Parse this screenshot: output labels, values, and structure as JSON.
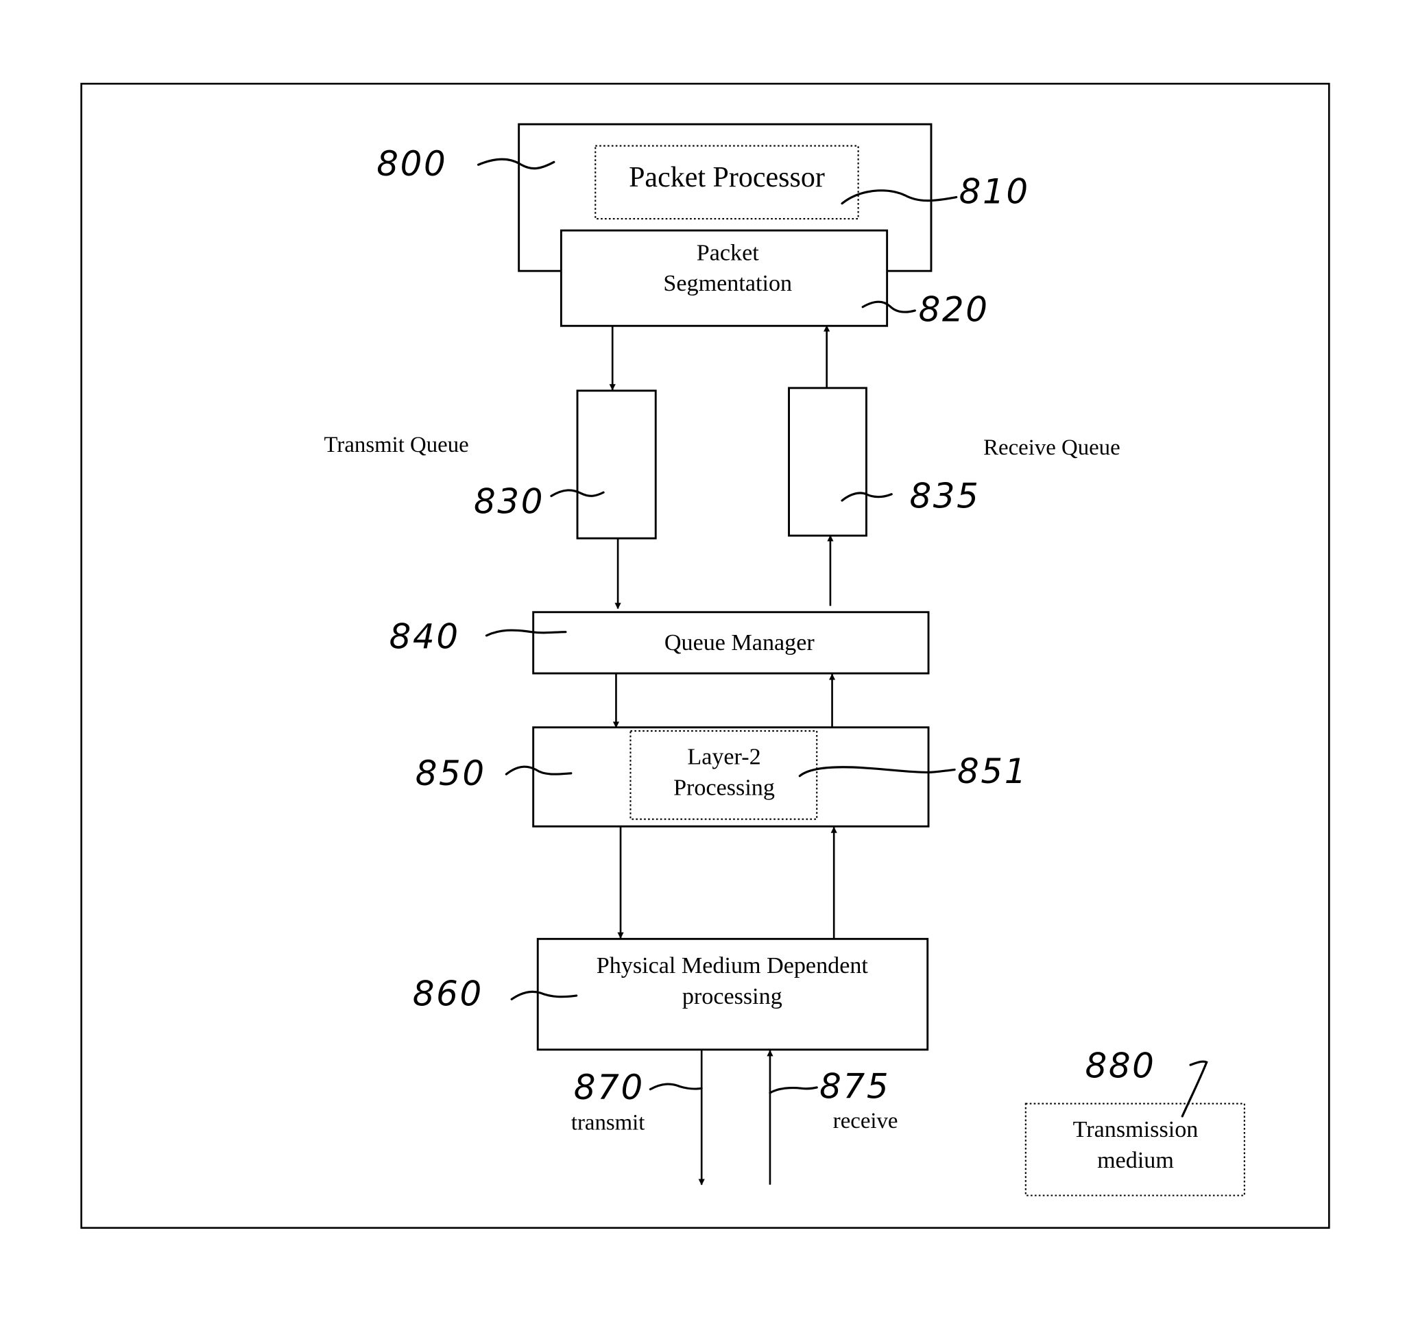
{
  "diagram": {
    "type": "block-diagram",
    "blocks": {
      "outer": {
        "ref": "800"
      },
      "packet_processor": {
        "ref": "810",
        "label": "Packet Processor"
      },
      "packet_segmentation": {
        "ref": "820",
        "label_line1": "Packet",
        "label_line2": "Segmentation"
      },
      "transmit_queue": {
        "ref": "830",
        "label": "Transmit Queue"
      },
      "receive_queue": {
        "ref": "835",
        "label": "Receive Queue"
      },
      "queue_manager": {
        "ref": "840",
        "label": "Queue Manager"
      },
      "layer2_block": {
        "ref": "850"
      },
      "layer2_processing": {
        "ref": "851",
        "label_line1": "Layer-2",
        "label_line2": "Processing"
      },
      "pmd": {
        "ref": "860",
        "label_line1": "Physical Medium Dependent",
        "label_line2": "processing"
      },
      "transmit_line": {
        "ref": "870",
        "label": "transmit"
      },
      "receive_line": {
        "ref": "875",
        "label": "receive"
      },
      "transmission_medium": {
        "ref": "880",
        "label_line1": "Transmission",
        "label_line2": "medium"
      }
    },
    "connections": [
      {
        "from": "packet_segmentation",
        "to": "transmit_queue"
      },
      {
        "from": "receive_queue",
        "to": "packet_segmentation"
      },
      {
        "from": "transmit_queue",
        "to": "queue_manager"
      },
      {
        "from": "queue_manager",
        "to": "receive_queue"
      },
      {
        "from": "queue_manager",
        "to": "layer2_block"
      },
      {
        "from": "layer2_block",
        "to": "queue_manager"
      },
      {
        "from": "layer2_block",
        "to": "pmd"
      },
      {
        "from": "pmd",
        "to": "layer2_block"
      },
      {
        "from": "pmd",
        "to": "transmit_line"
      },
      {
        "from": "receive_line",
        "to": "pmd"
      }
    ]
  }
}
